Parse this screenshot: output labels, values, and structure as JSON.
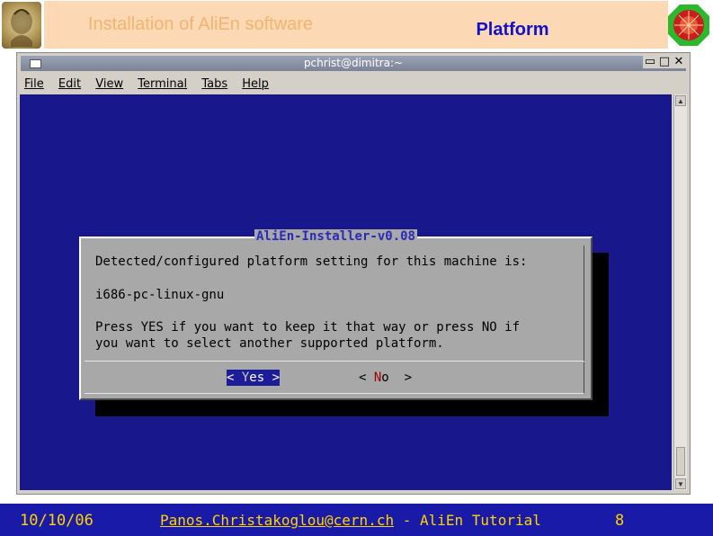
{
  "header": {
    "left_title": "Installation of AliEn software",
    "right_title": "Platform",
    "left_logo_icon": "crest-logo-icon",
    "right_logo_icon": "alice-logo-icon"
  },
  "window": {
    "title": "pchrist@dimitra:~",
    "controls": [
      "▭",
      "□",
      "✕"
    ],
    "menu": [
      "File",
      "Edit",
      "View",
      "Terminal",
      "Tabs",
      "Help"
    ]
  },
  "dialog": {
    "title": "AliEn-Installer-v0.08",
    "line1": "Detected/configured platform setting for this machine is:",
    "line2": "i686-pc-linux-gnu",
    "line3": "Press YES if you want to keep it that way or press NO if",
    "line4": "you want to select another supported platform.",
    "yes_open": "< ",
    "yes_hot": "Y",
    "yes_rest": "es >",
    "no_open": "< ",
    "no_hot": "N",
    "no_rest": "o  >"
  },
  "footer": {
    "date": "10/10/06",
    "email": "Panos.Christakoglou@cern.ch",
    "suffix": " - AliEn Tutorial",
    "page": "8"
  },
  "colors": {
    "terminal_bg": "#18188c",
    "dialog_bg": "#a8a8a8",
    "footer_bg": "#1a1aa8",
    "footer_text": "#ffd200",
    "header_bg": "#fdd8b4"
  }
}
